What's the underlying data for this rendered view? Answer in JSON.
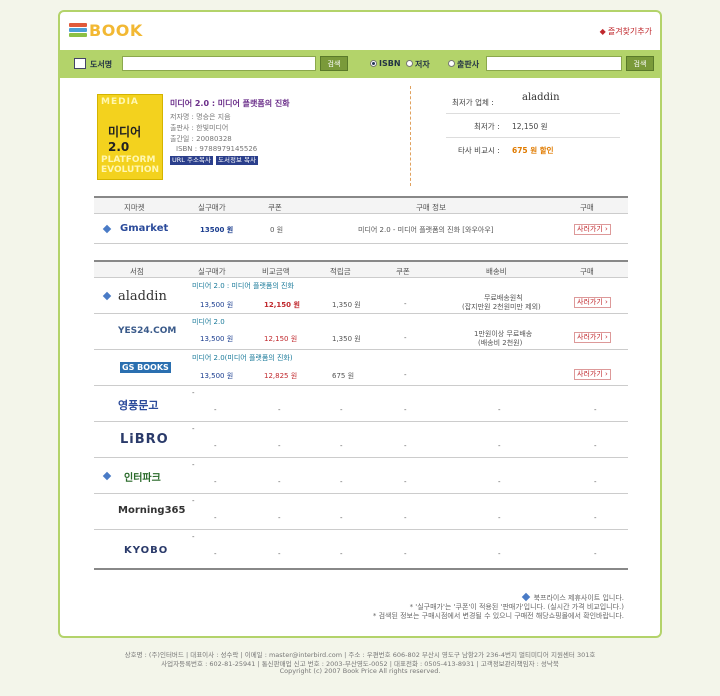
{
  "header": {
    "logo_text": "BOOK",
    "favorites_label": "즐겨찾기추가"
  },
  "search": {
    "title_label": "도서명",
    "title_value": "",
    "button_label": "검색",
    "radio_isbn": "ISBN",
    "radio_author": "저자",
    "radio_publisher": "출판사",
    "field_value": "",
    "button2_label": "검색"
  },
  "book": {
    "cover_top": "MEDIA",
    "cover_title": "미디어 2.0",
    "cover_bottom": "PLATFORM EVOLUTION",
    "title": "미디어 2.0 : 미디어 플랫폼의 진화",
    "author": "저자명 : 명승은 지음",
    "publisher": "출판사 : 한빛미디어",
    "pubdate": "출간일 : 20080328",
    "isbn": "ISBN : 9788979145526",
    "tag1": "URL 주소복사",
    "tag2": "도서정보 복사"
  },
  "lowest": {
    "store_label": "최저가 업체 :",
    "store_name": "aladdin",
    "price_label": "최저가 :",
    "price_value": "12,150 원",
    "compare_label": "타사 비교시 :",
    "compare_value": "675 원 할인"
  },
  "market_table": {
    "headers": [
      "지마켓",
      "실구매가",
      "쿠폰",
      "구매 정보",
      "구매"
    ],
    "row": {
      "store": "Gmarket",
      "price": "13500 원",
      "coupon": "0 원",
      "info": "미디어 2.0 - 미디어 플랫폼의 진화 [와우아우]",
      "buy": "사러가기"
    }
  },
  "store_table": {
    "headers": [
      "서점",
      "실구매가",
      "비교금액",
      "적립금",
      "쿠폰",
      "배송비",
      "구매"
    ],
    "rows": [
      {
        "store": "aladdin",
        "title": "미디어 2.0 : 미디어 플랫폼의 진화",
        "price": "13,500 원",
        "compare": "12,150 원",
        "points": "1,350 원",
        "coupon": "-",
        "ship1": "무료배송원칙",
        "ship2": "(잡지만원 2천원미만 제외)",
        "buy": "사러가기"
      },
      {
        "store": "YES24.COM",
        "title": "미디어 2.0",
        "price": "13,500 원",
        "compare": "12,150 원",
        "points": "1,350 원",
        "coupon": "-",
        "ship1": "1만원이상 무료배송",
        "ship2": "(배송비 2천원)",
        "buy": "사러가기"
      },
      {
        "store": "GS BOOKS",
        "title": "미디어 2.0(미디어 플랫폼의 진화)",
        "price": "13,500 원",
        "compare": "12,825 원",
        "points": "675 원",
        "coupon": "-",
        "ship1": "",
        "ship2": "",
        "buy": "사러가기"
      },
      {
        "store": "영풍문고",
        "title": "-",
        "price": "-",
        "compare": "-",
        "points": "-",
        "coupon": "-",
        "ship1": "-",
        "ship2": "",
        "buy": "-"
      },
      {
        "store": "LiBRO",
        "title": "-",
        "price": "-",
        "compare": "-",
        "points": "-",
        "coupon": "-",
        "ship1": "-",
        "ship2": "",
        "buy": "-"
      },
      {
        "store": "인터파크",
        "title": "-",
        "price": "-",
        "compare": "-",
        "points": "-",
        "coupon": "-",
        "ship1": "-",
        "ship2": "",
        "buy": "-"
      },
      {
        "store": "Morning365",
        "title": "-",
        "price": "-",
        "compare": "-",
        "points": "-",
        "coupon": "-",
        "ship1": "-",
        "ship2": "",
        "buy": "-"
      },
      {
        "store": "KYOBO",
        "title": "-",
        "price": "-",
        "compare": "-",
        "points": "-",
        "coupon": "-",
        "ship1": "-",
        "ship2": "",
        "buy": "-"
      }
    ]
  },
  "notes": {
    "line1": "북프라이스 제휴사이트 입니다.",
    "line2": "* '실구매가'는 '쿠폰'이 적용된 '판매가'입니다. (실시간 가격 비교입니다.)",
    "line3": "* 검색된 정보는 구매시점에서 변경될 수 있으니 구매전 해당쇼핑몰에서 확인바랍니다."
  },
  "footer": {
    "line1": "상호명 : (주)인터버드 | 대표이사 : 성수락 | 이메일 : master@interbird.com | 주소 : 우편번호 606-802 부산시 영도구 남항2가 236-4번지 멀티미디어 지원센터 301호",
    "line2": "사업자등록번호 : 602-81-25941 | 통신판매업 신고 번호 : 2003-부산영도-0052 | 대표전화 : 0505-413-8931 | 고객정보관리책임자 : 성낙북",
    "line3": "Copyright (c) 2007 Book Price All rights reserved."
  },
  "colors": {
    "frame": "#b3d36a",
    "accent_red": "#c0282d",
    "price_blue": "#1a3d8f",
    "discount_orange": "#e07b00"
  }
}
